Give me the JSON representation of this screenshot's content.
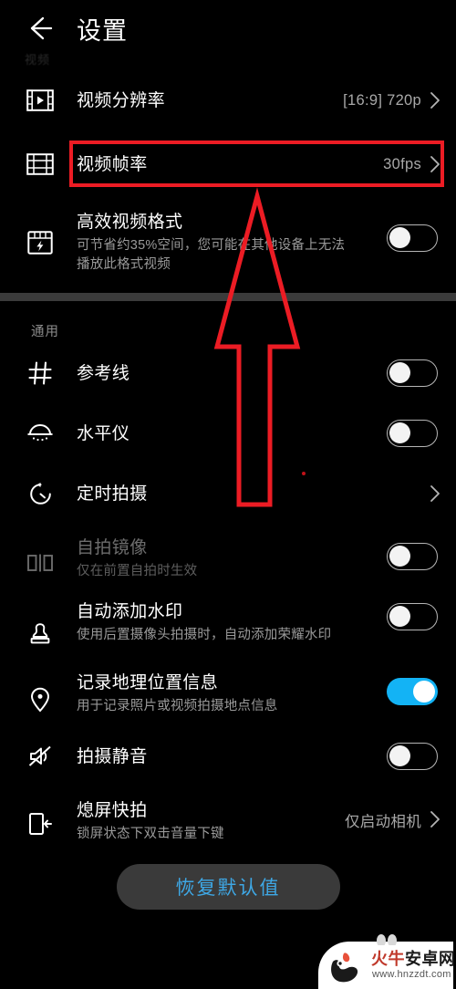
{
  "header": {
    "back_icon": "back-arrow-icon",
    "title": "设置",
    "ghost_text": "视频"
  },
  "colors": {
    "accent_blue": "#13b3f5",
    "highlight_red": "#ec1c24",
    "button_text_blue": "#3ea8e6",
    "background": "#000000",
    "separator": "#3b3b3b"
  },
  "video_section": {
    "rows": [
      {
        "icon": "video-resolution-icon",
        "title": "视频分辨率",
        "sub": "",
        "value": "[16:9] 720p",
        "control": "chevron",
        "dim": false
      },
      {
        "icon": "video-framerate-icon",
        "title": "视频帧率",
        "sub": "",
        "value": "30fps",
        "control": "chevron",
        "dim": false
      },
      {
        "icon": "efficient-video-format-icon",
        "title": "高效视频格式",
        "sub": "可节省约35%空间，您可能在其他设备上无法播放此格式视频",
        "value": "",
        "control": "toggle-off",
        "dim": false
      }
    ]
  },
  "general_section": {
    "label": "通用",
    "rows": [
      {
        "icon": "grid-lines-icon",
        "title": "参考线",
        "sub": "",
        "value": "",
        "control": "toggle-off",
        "dim": false
      },
      {
        "icon": "level-meter-icon",
        "title": "水平仪",
        "sub": "",
        "value": "",
        "control": "toggle-off",
        "dim": false
      },
      {
        "icon": "timer-icon",
        "title": "定时拍摄",
        "sub": "",
        "value": "",
        "control": "chevron",
        "dim": false
      },
      {
        "icon": "selfie-mirror-icon",
        "title": "自拍镜像",
        "sub": "仅在前置自拍时生效",
        "value": "",
        "control": "toggle-off",
        "dim": true
      },
      {
        "icon": "watermark-stamp-icon",
        "title": "自动添加水印",
        "sub": "使用后置摄像头拍摄时，自动添加荣耀水印",
        "value": "",
        "control": "toggle-off",
        "dim": false
      },
      {
        "icon": "location-pin-icon",
        "title": "记录地理位置信息",
        "sub": "用于记录照片或视频拍摄地点信息",
        "value": "",
        "control": "toggle-on",
        "dim": false
      },
      {
        "icon": "mute-speaker-icon",
        "title": "拍摄静音",
        "sub": "",
        "value": "",
        "control": "toggle-off",
        "dim": false
      },
      {
        "icon": "quick-snapshot-icon",
        "title": "熄屏快拍",
        "sub": "锁屏状态下双击音量下键",
        "value": "仅启动相机",
        "control": "chevron",
        "dim": false
      }
    ]
  },
  "footer": {
    "reset_label": "恢复默认值"
  },
  "annotation": {
    "highlight_target": "视频帧率",
    "arrow": "red-up-arrow-annotation"
  },
  "watermark": {
    "name_red": "火牛",
    "name_black": "安卓网",
    "url": "www.hnzzdt.com"
  }
}
